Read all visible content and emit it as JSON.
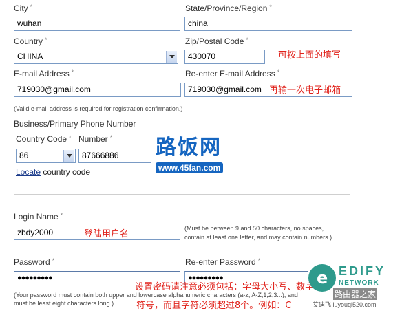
{
  "required_mark": "*",
  "city": {
    "label": "City",
    "value": "wuhan"
  },
  "state": {
    "label": "State/Province/Region",
    "value": "china"
  },
  "country": {
    "label": "Country",
    "value": "CHINA"
  },
  "zip": {
    "label": "Zip/Postal Code",
    "value": "430070"
  },
  "zip_note": "可按上面的填写",
  "email": {
    "label": "E-mail Address",
    "value": "719030@gmail.com"
  },
  "reemail": {
    "label": "Re-enter E-mail Address",
    "value": "719030@gmail.com"
  },
  "reemail_note": "再输一次电子邮箱",
  "email_hint": "(Valid e-mail address is required for registration confirmation.)",
  "phone": {
    "heading": "Business/Primary Phone Number",
    "country_code_label": "Country Code",
    "country_code_value": "86",
    "number_label": "Number",
    "number_value": "87666886",
    "locate_link": "Locate",
    "locate_suffix": "country code"
  },
  "watermark_top": {
    "brand": "路饭网",
    "url": "www.45fan.com"
  },
  "login": {
    "label": "Login Name",
    "value": "zbdy2000",
    "note": "登陆用户名",
    "hint": "(Must be between 9 and 50 characters, no spaces, contain at least one letter, and may contain numbers.)"
  },
  "password": {
    "label": "Password",
    "value": "●●●●●●●●●"
  },
  "repassword": {
    "label": "Re-enter Password",
    "value": "●●●●●●●●●"
  },
  "password_hint_line1": "(Your password must contain both upper and lowercase alphanumeric characters (a-z, A-Z,1,2,3...), and",
  "password_hint_line2": "must be least eight characters long.)",
  "password_note_line1": "设置密码请注意必须包括：字母大小写、数字",
  "password_note_line2": "符号，而且字符必须超过8个。例如：C",
  "watermark_bottom": {
    "brand": "EDIFY",
    "sub": "NETWORK",
    "cn": "路由器之家",
    "small": "艾迪飞 luyouqi520.com"
  },
  "colors": {
    "accent_red": "#e0211a",
    "input_border": "#7a9bc5",
    "link": "#1a3a8a"
  }
}
